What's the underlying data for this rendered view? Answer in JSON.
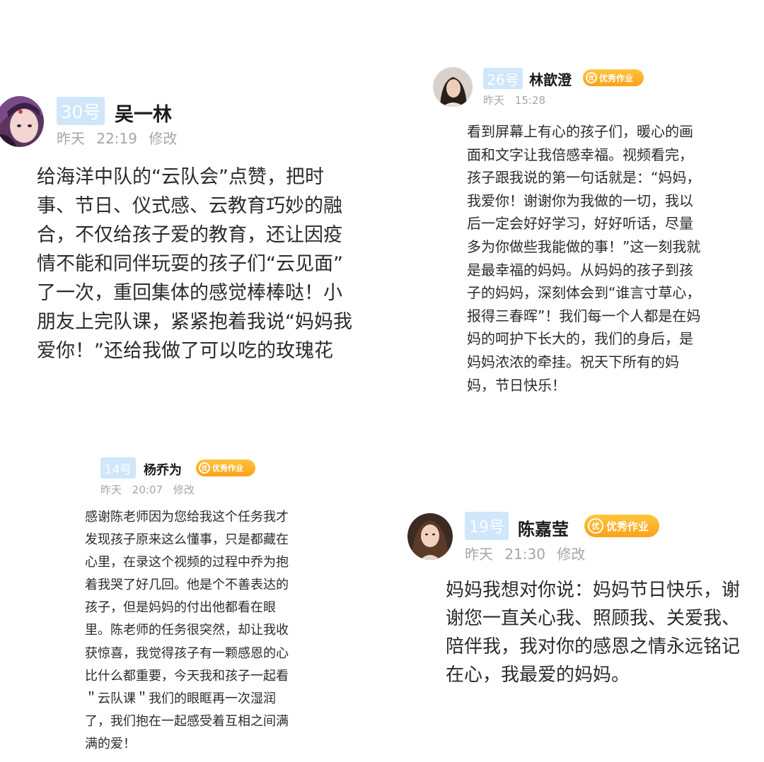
{
  "posts": [
    {
      "number": "30号",
      "name": "吴一林",
      "honor": "",
      "date": "昨天",
      "time": "22:19",
      "edit": "修改",
      "avatar": "anime-avatar",
      "text": "给海洋中队的“云队会”点赞，把时\n事、节日、仪式感、云教育巧妙的融\n合，不仅给孩子爱的教育，还让因疫\n情不能和同伴玩耍的孩子们“云见面”\n了一次，重回集体的感觉棒棒哒！小\n朋友上完队课，紧紧抱着我说“妈妈我\n爱你！”还给我做了可以吃的玫瑰花"
    },
    {
      "number": "26号",
      "name": "林歆澄",
      "honor": "优秀作业",
      "date": "昨天",
      "time": "15:28",
      "edit": "",
      "avatar": "photo-avatar",
      "text": "看到屏幕上有心的孩子们，暖心的画\n面和文字让我倍感幸福。视频看完，\n孩子跟我说的第一句话就是：“妈妈，\n我爱你！谢谢你为我做的一切，我以\n后一定会好好学习，好好听话，尽量\n多为你做些我能做的事！”这一刻我就\n是最幸福的妈妈。从妈妈的孩子到孩\n子的妈妈，深刻体会到“谁言寸草心，\n报得三春晖”！我们每一个人都是在妈\n妈的呵护下长大的，我们的身后，是\n妈妈浓浓的牵挂。祝天下所有的妈\n妈，节日快乐！"
    },
    {
      "number": "14号",
      "name": "杨乔为",
      "honor": "优秀作业",
      "date": "昨天",
      "time": "20:07",
      "edit": "修改",
      "avatar": "",
      "text": "感谢陈老师因为您给我这个任务我才\n发现孩子原来这么懂事，只是都藏在\n心里，在录这个视频的过程中乔为抱\n着我哭了好几回。他是个不善表达的\n孩子，但是妈妈的付出他都看在眼\n里。陈老师的任务很突然，却让我收\n获惊喜，我觉得孩子有一颗感恩的心\n比什么都重要，今天我和孩子一起看\n＂云队课＂我们的眼眶再一次湿润\n了，我们抱在一起感受着互相之间满\n满的爱！"
    },
    {
      "number": "19号",
      "name": "陈嘉莹",
      "honor": "优秀作业",
      "date": "昨天",
      "time": "21:30",
      "edit": "修改",
      "avatar": "photo-avatar",
      "text": "妈妈我想对你说：妈妈节日快乐，谢\n谢您一直关心我、照顾我、关爱我、\n陪伴我，我对你的感恩之情永远铭记\n在心，我最爱的妈妈。"
    }
  ],
  "honor_medal_glyph": "优",
  "colors": {
    "badge_bg": "#cfe6fb",
    "honor_bg": "#fba11a",
    "meta_text": "#a6a6a6"
  }
}
